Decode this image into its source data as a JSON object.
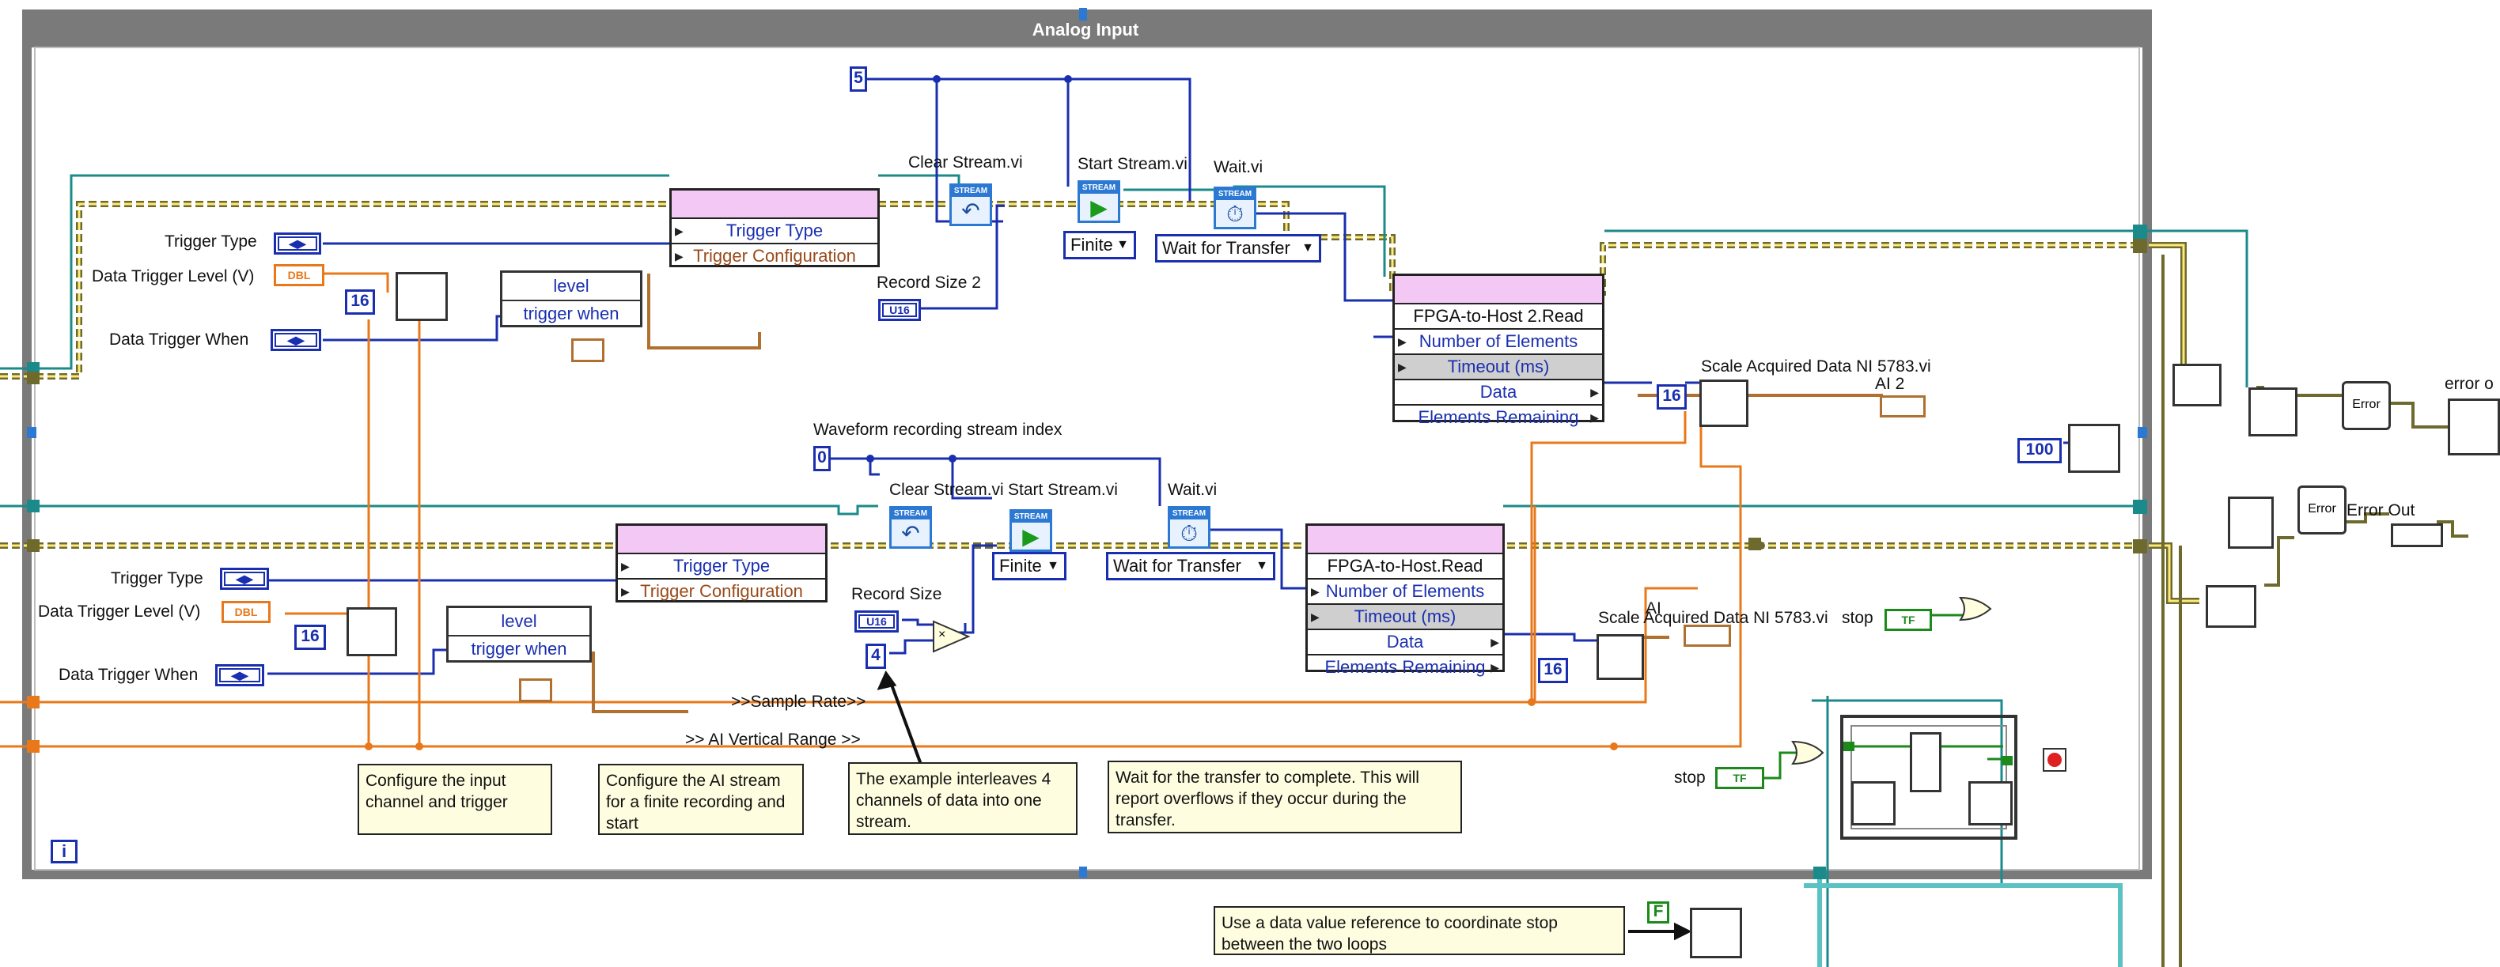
{
  "window": {
    "frame_title": "Analog Input",
    "info_glyph": "i"
  },
  "upper_loop": {
    "const_5": "5",
    "clear_stream_label": "Clear Stream.vi",
    "start_stream_label": "Start Stream.vi",
    "wait_label": "Wait.vi",
    "trigger_type_label": "Trigger Type",
    "data_trigger_level_label": "Data Trigger Level (V)",
    "data_trigger_when_label": "Data Trigger When",
    "const_16": "16",
    "bundle_level": "level",
    "bundle_trigger_when": "trigger when",
    "trigger_node_rows": [
      "Trigger Type",
      "Trigger Configuration"
    ],
    "finite_enum": "Finite",
    "wait_for_transfer_enum": "Wait for Transfer",
    "record_size_label": "Record Size 2",
    "record_size_type": "U16",
    "fifo_node": {
      "title": "FPGA-to-Host 2.Read",
      "rows": [
        "Number of Elements",
        "Timeout (ms)",
        "Data",
        "Elements Remaining"
      ]
    },
    "scale_label": "Scale Acquired Data NI 5783.vi",
    "scale_const": "16",
    "indicator_label": "AI 2",
    "wait_const": "100",
    "error_out_label": "error o"
  },
  "lower_loop": {
    "waveform_index_label": "Waveform recording stream index",
    "const_0": "0",
    "clear_stream_label": "Clear Stream.vi",
    "start_stream_label": "Start Stream.vi",
    "wait_label": "Wait.vi",
    "trigger_type_label": "Trigger Type",
    "data_trigger_level_label": "Data Trigger Level (V)",
    "data_trigger_when_label": "Data Trigger When",
    "const_16": "16",
    "bundle_level": "level",
    "bundle_trigger_when": "trigger when",
    "trigger_node_rows": [
      "Trigger Type",
      "Trigger Configuration"
    ],
    "finite_enum": "Finite",
    "wait_for_transfer_enum": "Wait for Transfer",
    "record_size_label": "Record Size",
    "record_size_type": "U16",
    "const_4": "4",
    "fifo_node": {
      "title": "FPGA-to-Host.Read",
      "rows": [
        "Number of Elements",
        "Timeout (ms)",
        "Data",
        "Elements Remaining"
      ]
    },
    "scale_label": "Scale Acquired Data NI 5783.vi",
    "scale_const": "16",
    "indicator_label": "AI",
    "stop_label": "stop",
    "stop_label_2": "stop",
    "error_out_label": "Error Out",
    "sample_rate_label": ">>Sample Rate>>",
    "vertical_range_label": ">> AI Vertical Range >>"
  },
  "comments": {
    "configure_input": "Configure the input channel and trigger",
    "configure_ai": "Configure the AI stream for a finite recording and start",
    "interleave": "The example interleaves 4 channels of data into one stream.",
    "wait_transfer": "Wait for the transfer to complete.  This will report overflows if they occur during the transfer.",
    "data_value_ref": "Use a data value reference to coordinate stop between the two loops"
  },
  "misc": {
    "bool_const": "F",
    "tf_label": "TF",
    "dbl_label": "DBL",
    "enum_glyph": "◀▶",
    "error_glyph": "Error",
    "dropdown_glyph": "▼"
  },
  "colors": {
    "frame_gray": "#7a7a7a",
    "wire_blue": "#1a2fb0",
    "wire_orange": "#e8781a",
    "wire_teal": "#1a8a8a",
    "wire_cluster": "#6e6a2e",
    "wire_stream": "#c47a2a",
    "node_pink": "#f4c8f4",
    "comment_bg": "#fffde0"
  }
}
